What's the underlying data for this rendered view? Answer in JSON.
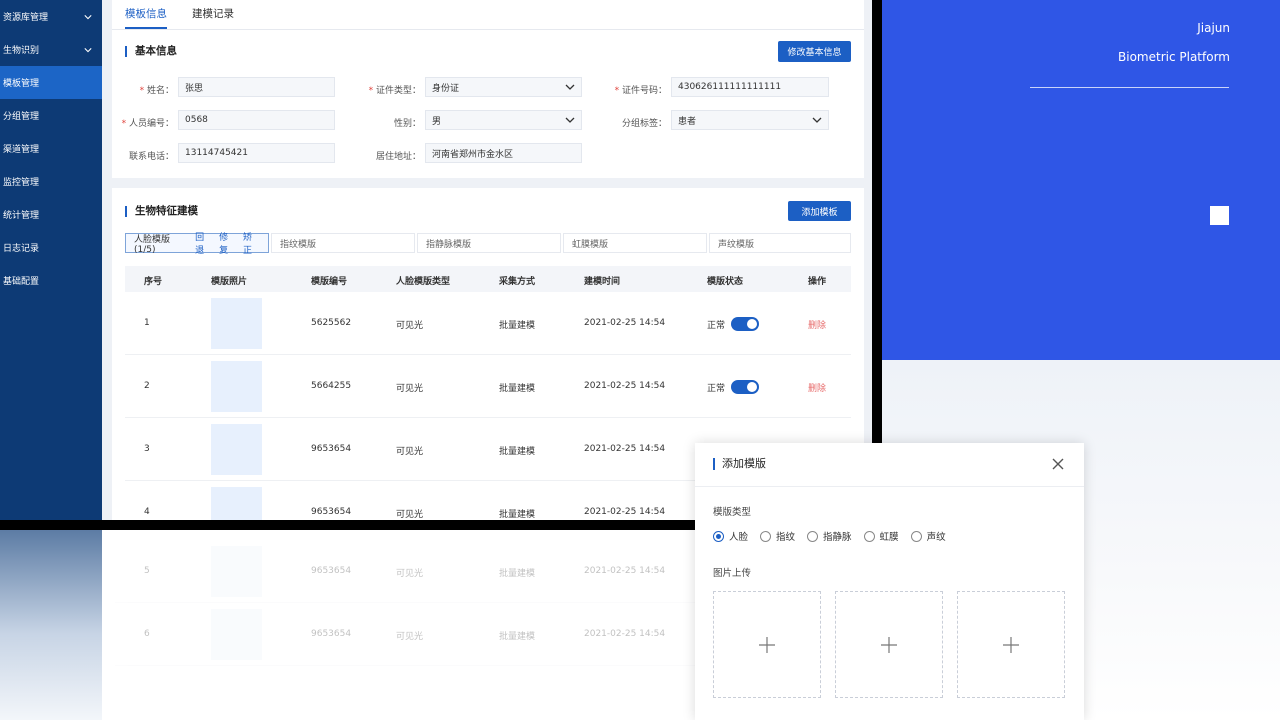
{
  "brand": {
    "title": "Jiajun",
    "subtitle": "Biometric Platform"
  },
  "sidebar": {
    "items": [
      {
        "label": "资源库管理",
        "expandable": true
      },
      {
        "label": "生物识别",
        "expandable": true
      },
      {
        "label": "模板管理",
        "active": true
      },
      {
        "label": "分组管理"
      },
      {
        "label": "渠道管理"
      },
      {
        "label": "监控管理"
      },
      {
        "label": "统计管理"
      },
      {
        "label": "日志记录"
      },
      {
        "label": "基础配置"
      }
    ]
  },
  "tabs": [
    "模板信息",
    "建模记录"
  ],
  "basic_info": {
    "title": "基本信息",
    "edit_button": "修改基本信息",
    "fields": {
      "name": {
        "label": "姓名：",
        "value": "张思"
      },
      "id_type": {
        "label": "证件类型：",
        "value": "身份证"
      },
      "id_number": {
        "label": "证件号码：",
        "value": "430626111111111111"
      },
      "person_no": {
        "label": "人员编号：",
        "value": "0568"
      },
      "gender": {
        "label": "性别：",
        "value": "男"
      },
      "group_tag": {
        "label": "分组标签：",
        "value": "患者"
      },
      "phone": {
        "label": "联系电话：",
        "value": "13114745421"
      },
      "address": {
        "label": "居住地址：",
        "value": "河南省郑州市金水区"
      }
    }
  },
  "bio": {
    "title": "生物特征建模",
    "add_button": "添加模板",
    "modality_tabs": {
      "face": {
        "label": "人脸模版(1/5)",
        "actions": [
          "回退",
          "修复",
          "矫正"
        ]
      },
      "others": [
        "指纹模版",
        "指静脉模版",
        "虹膜模版",
        "声纹模版"
      ]
    },
    "table": {
      "columns": [
        "序号",
        "模版照片",
        "模版编号",
        "人脸模版类型",
        "采集方式",
        "建模时间",
        "模版状态",
        "操作"
      ],
      "rows": [
        {
          "no": "1",
          "code": "5625562",
          "type": "可见光",
          "method": "批量建模",
          "time": "2021-02-25 14:54",
          "status": "正常",
          "action": "删除"
        },
        {
          "no": "2",
          "code": "5664255",
          "type": "可见光",
          "method": "批量建模",
          "time": "2021-02-25 14:54",
          "status": "正常",
          "action": "删除"
        },
        {
          "no": "3",
          "code": "9653654",
          "type": "可见光",
          "method": "批量建模",
          "time": "2021-02-25 14:54"
        },
        {
          "no": "4",
          "code": "9653654",
          "type": "可见光",
          "method": "批量建模",
          "time": "2021-02-25 14:54"
        },
        {
          "no": "5",
          "code": "9653654",
          "type": "可见光",
          "method": "批量建模",
          "time": "2021-02-25 14:54"
        },
        {
          "no": "6",
          "code": "9653654",
          "type": "可见光",
          "method": "批量建模",
          "time": "2021-02-25 14:54"
        }
      ]
    }
  },
  "dialog": {
    "title": "添加模版",
    "type_label": "模版类型",
    "types": [
      "人脸",
      "指纹",
      "指静脉",
      "虹膜",
      "声纹"
    ],
    "selected_type": "人脸",
    "upload_label": "图片上传"
  },
  "colors": {
    "accent": "#1c5fc4",
    "sidebar": "#0d3a75",
    "brand_bg": "#2f56e6"
  }
}
